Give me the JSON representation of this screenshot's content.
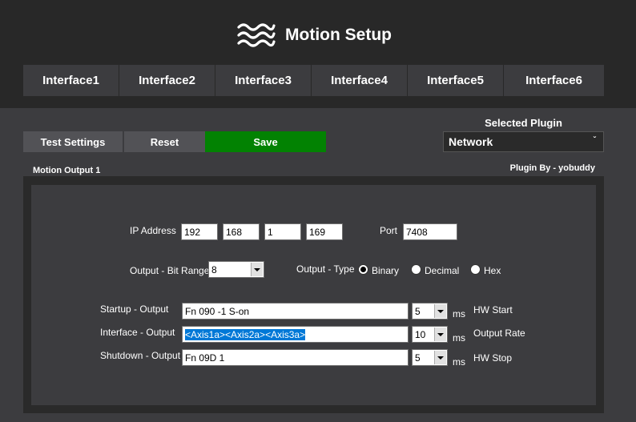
{
  "header": {
    "title": "Motion Setup",
    "logo_icon": "wave-logo-icon"
  },
  "tabs": [
    "Interface1",
    "Interface2",
    "Interface3",
    "Interface4",
    "Interface5",
    "Interface6"
  ],
  "toolbar": {
    "test_label": "Test Settings",
    "reset_label": "Reset",
    "save_label": "Save",
    "save_color": "#028202"
  },
  "plugin": {
    "label": "Selected Plugin",
    "value": "Network",
    "by": "Plugin By - yobuddy"
  },
  "panel": {
    "title": "Motion Output 1",
    "ip_label": "IP Address",
    "ip": [
      "192",
      "168",
      "1",
      "169"
    ],
    "port_label": "Port",
    "port": "7408",
    "bit_range_label": "Output - Bit Range",
    "bit_range": "8",
    "type_label": "Output - Type",
    "types": [
      "Binary",
      "Decimal",
      "Hex"
    ],
    "type_selected": "Binary",
    "startup": {
      "label": "Startup - Output",
      "value": "Fn 090 -1 S-on",
      "rate": "5",
      "unit": "ms",
      "note": "HW Start"
    },
    "interface": {
      "label": "Interface - Output",
      "value": "<Axis1a><Axis2a><Axis3a>",
      "rate": "10",
      "unit": "ms",
      "note": "Output Rate"
    },
    "shutdown": {
      "label": "Shutdown - Output",
      "value": "Fn 09D 1",
      "rate": "5",
      "unit": "ms",
      "note": "HW Stop"
    }
  }
}
